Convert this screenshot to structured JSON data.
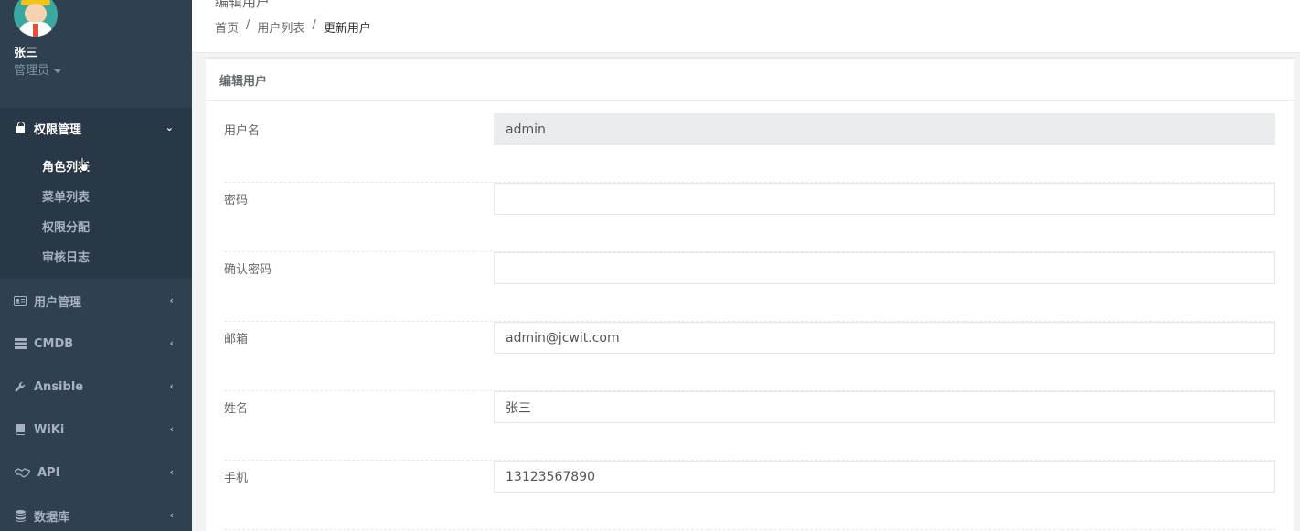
{
  "sidebar": {
    "user_name": "张三",
    "user_role": "管理员",
    "menu": [
      {
        "label": "权限管理",
        "icon": "lock-icon",
        "expanded": true,
        "children": [
          "角色列表",
          "菜单列表",
          "权限分配",
          "审核日志"
        ]
      },
      {
        "label": "用户管理",
        "icon": "id-card-icon"
      },
      {
        "label": "CMDB",
        "icon": "server-icon"
      },
      {
        "label": "Ansible",
        "icon": "wrench-icon"
      },
      {
        "label": "WiKi",
        "icon": "book-icon"
      },
      {
        "label": "API",
        "icon": "handshake-icon"
      },
      {
        "label": "数据库",
        "icon": "database-icon"
      }
    ]
  },
  "header": {
    "title": "编辑用户",
    "breadcrumb": [
      "首页",
      "用户列表",
      "更新用户"
    ],
    "sep": "/"
  },
  "panel": {
    "title": "编辑用户"
  },
  "form": {
    "username": {
      "label": "用户名",
      "value": "admin"
    },
    "password": {
      "label": "密码",
      "value": ""
    },
    "confirm": {
      "label": "确认密码",
      "value": ""
    },
    "email": {
      "label": "邮箱",
      "value": "admin@jcwit.com"
    },
    "fullname": {
      "label": "姓名",
      "value": "张三"
    },
    "phone": {
      "label": "手机",
      "value": "13123567890"
    }
  },
  "colors": {
    "sidebar_bg": "#2f4050",
    "sidebar_active_bg": "#293846",
    "page_bg": "#f3f3f4",
    "readonly_bg": "#e9ecef"
  }
}
